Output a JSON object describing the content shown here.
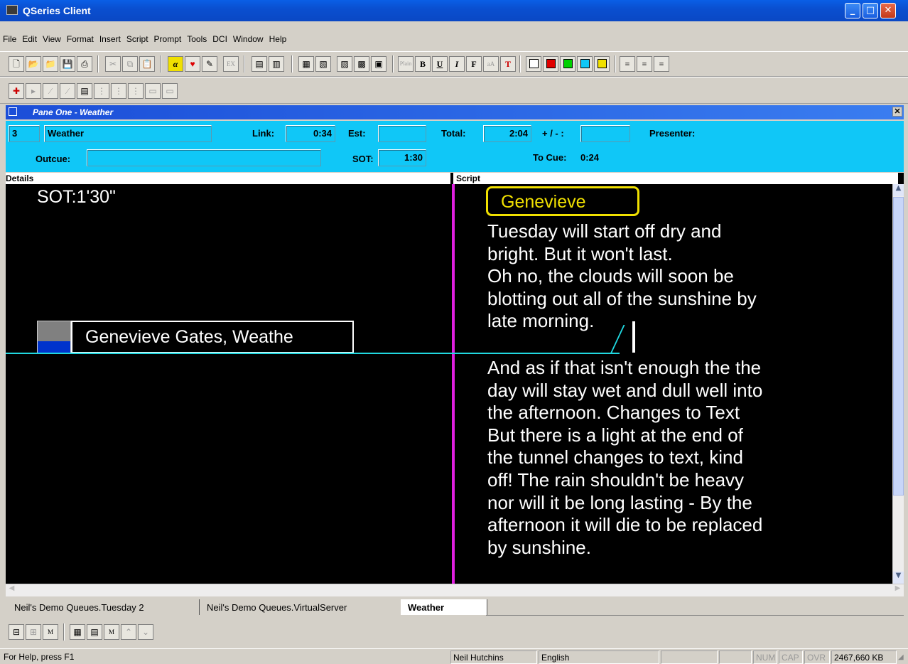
{
  "window": {
    "title": "QSeries Client"
  },
  "menu": [
    "File",
    "Edit",
    "View",
    "Format",
    "Insert",
    "Script",
    "Prompt",
    "Tools",
    "DCI",
    "Window",
    "Help"
  ],
  "pane": {
    "title": "Pane One - Weather"
  },
  "info": {
    "number": "3",
    "slug": "Weather",
    "link_label": "Link:",
    "link_value": "0:34",
    "est_label": "Est:",
    "est_value": "",
    "total_label": "Total:",
    "total_value": "2:04",
    "plusminus_label": "+ / - :",
    "plusminus_value": "",
    "presenter_label": "Presenter:",
    "outcue_label": "Outcue:",
    "outcue_value": "",
    "sot_label": "SOT:",
    "sot_value": "1:30",
    "tocue_label": "To Cue:",
    "tocue_value": "0:24"
  },
  "sections": {
    "details": "Details",
    "script": "Script"
  },
  "details": {
    "sot": "SOT:1'30\"",
    "caption": "Genevieve Gates, Weathe"
  },
  "script": {
    "presenter": "Genevieve",
    "block1": "Tuesday will start off dry and\nbright. But it won't last.\nOh no, the clouds will soon be\nblotting out all of the sunshine by\nlate morning.",
    "block2": "And as if that isn't enough the the\nday will stay wet and dull well into\nthe afternoon. Changes to Text\nBut there is a light at the end of\nthe tunnel changes to text, kind\noff! The rain shouldn't be heavy\nnor will it be long lasting - By the\nafternoon it will die to be replaced\nby sunshine."
  },
  "tabs": [
    "Neil's Demo Queues.Tuesday 2",
    "Neil's Demo Queues.VirtualServer",
    "Weather"
  ],
  "status": {
    "help": "For Help, press F1",
    "user": "Neil Hutchins",
    "language": "English",
    "num": "NUM",
    "cap": "CAP",
    "ovr": "OVR",
    "memory": "2467,660 KB"
  },
  "colors": {
    "accent": "#10c7f7",
    "title": "#0a4fd0",
    "marker": "#e020e0",
    "cue_line": "#20d8e0",
    "presenter_box": "#f0e000"
  }
}
